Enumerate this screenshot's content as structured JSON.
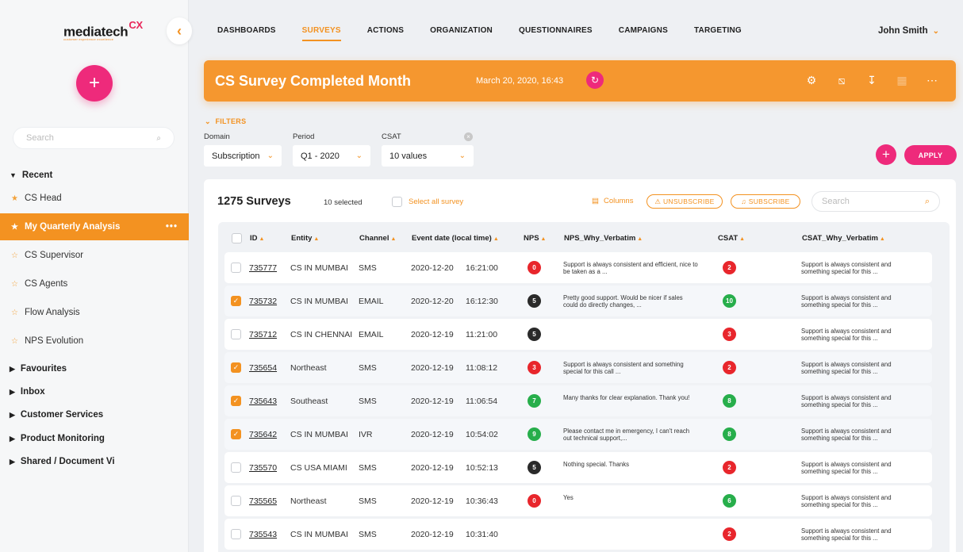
{
  "logo": {
    "text": "mediatech",
    "mark": "CX",
    "tagline": "customer experience excellence"
  },
  "sidebar": {
    "search_placeholder": "Search",
    "recent_label": "Recent",
    "items": [
      {
        "label": "CS Head"
      },
      {
        "label": "My Quarterly Analysis",
        "active": true,
        "more": "•••"
      },
      {
        "label": "CS Supervisor"
      },
      {
        "label": "CS Agents"
      },
      {
        "label": "Flow Analysis"
      },
      {
        "label": "NPS Evolution"
      }
    ],
    "sections": [
      "Favourites",
      "Inbox",
      "Customer Services",
      "Product Monitoring",
      "Shared / Document Vi"
    ]
  },
  "nav": {
    "items": [
      "DASHBOARDS",
      "SURVEYS",
      "ACTIONS",
      "ORGANIZATION",
      "QUESTIONNAIRES",
      "CAMPAIGNS",
      "TARGETING"
    ],
    "selected": "SURVEYS"
  },
  "user": {
    "name": "John Smith"
  },
  "banner": {
    "title": "CS Survey Completed Month",
    "date": "March 20, 2020, 16:43",
    "color": "#f5972f"
  },
  "filters": {
    "label": "FILTERS",
    "domain": {
      "label": "Domain",
      "value": "Subscription"
    },
    "period": {
      "label": "Period",
      "value": "Q1 - 2020"
    },
    "csat": {
      "label": "CSAT",
      "value": "10 values"
    },
    "apply_label": "APPLY"
  },
  "surveys": {
    "count_label": "1275 Surveys",
    "selected_label": "10 selected",
    "select_all_label": "Select all survey",
    "columns_label": "Columns",
    "unsubscribe_label": "UNSUBSCRIBE",
    "subscribe_label": "SUBSCRIBE",
    "search_placeholder": "Search",
    "headers": {
      "id": "ID",
      "entity": "Entity",
      "channel": "Channel",
      "event_date": "Event  date (local time)",
      "nps": "NPS",
      "nps_verbatim": "NPS_Why_Verbatim",
      "csat": "CSAT",
      "csat_verbatim": "CSAT_Why_Verbatim"
    },
    "rows": [
      {
        "id": "735777",
        "entity": "CS IN MUMBAI",
        "channel": "SMS",
        "date": "2020-12-20",
        "time": "16:21:00",
        "nps": "0",
        "nps_color": "red",
        "nps_verbatim": "Support is always consistent and efficient, nice to be taken as a ...",
        "csat": "2",
        "csat_color": "red",
        "csat_verbatim": "Support is always consistent and something special for this ...",
        "checked": false
      },
      {
        "id": "735732",
        "entity": "CS IN MUMBAI",
        "channel": "EMAIL",
        "date": "2020-12-20",
        "time": "16:12:30",
        "nps": "5",
        "nps_color": "dark",
        "nps_verbatim": "Pretty good support. Would be nicer if sales could do directly changes, ...",
        "csat": "10",
        "csat_color": "green",
        "csat_verbatim": "Support is always consistent and something special for this ...",
        "checked": true
      },
      {
        "id": "735712",
        "entity": "CS IN CHENNAI",
        "channel": "EMAIL",
        "date": "2020-12-19",
        "time": "11:21:00",
        "nps": "5",
        "nps_color": "dark",
        "nps_verbatim": "",
        "csat": "3",
        "csat_color": "red",
        "csat_verbatim": "Support is always consistent and something special for this ...",
        "checked": false
      },
      {
        "id": "735654",
        "entity": "Northeast",
        "channel": "SMS",
        "date": "2020-12-19",
        "time": "11:08:12",
        "nps": "3",
        "nps_color": "red",
        "nps_verbatim": "Support is always consistent and something special for this call ...",
        "csat": "2",
        "csat_color": "red",
        "csat_verbatim": "Support is always consistent and something special for this ...",
        "checked": true
      },
      {
        "id": "735643",
        "entity": "Southeast",
        "channel": "SMS",
        "date": "2020-12-19",
        "time": "11:06:54",
        "nps": "7",
        "nps_color": "green",
        "nps_verbatim": "Many thanks for clear explanation. Thank you!",
        "csat": "8",
        "csat_color": "green",
        "csat_verbatim": "Support is always consistent and something special for this ...",
        "checked": true
      },
      {
        "id": "735642",
        "entity": "CS IN MUMBAI",
        "channel": "IVR",
        "date": "2020-12-19",
        "time": "10:54:02",
        "nps": "9",
        "nps_color": "green",
        "nps_verbatim": "Please contact me in emergency, I can't reach out technical support,...",
        "csat": "8",
        "csat_color": "green",
        "csat_verbatim": "Support is always consistent and something special for this ...",
        "checked": true
      },
      {
        "id": "735570",
        "entity": "CS USA MIAMI",
        "channel": "SMS",
        "date": "2020-12-19",
        "time": "10:52:13",
        "nps": "5",
        "nps_color": "dark",
        "nps_verbatim": "Nothing special. Thanks",
        "csat": "2",
        "csat_color": "red",
        "csat_verbatim": "Support is always consistent and something special for this ...",
        "checked": false
      },
      {
        "id": "735565",
        "entity": "Northeast",
        "channel": "SMS",
        "date": "2020-12-19",
        "time": "10:36:43",
        "nps": "0",
        "nps_color": "red",
        "nps_verbatim": "Yes",
        "csat": "6",
        "csat_color": "green",
        "csat_verbatim": "Support is always consistent and something special for this ...",
        "checked": false
      },
      {
        "id": "735543",
        "entity": "CS IN MUMBAI",
        "channel": "SMS",
        "date": "2020-12-19",
        "time": "10:31:40",
        "nps": "",
        "nps_color": "",
        "nps_verbatim": "",
        "csat": "2",
        "csat_color": "red",
        "csat_verbatim": "Support is always consistent and something special for this ...",
        "checked": false
      }
    ]
  },
  "colors": {
    "accent": "#f39221",
    "pink": "#ee2a7b",
    "red": "#e8262c",
    "green": "#27ae4b",
    "dark": "#2a2a2a"
  }
}
